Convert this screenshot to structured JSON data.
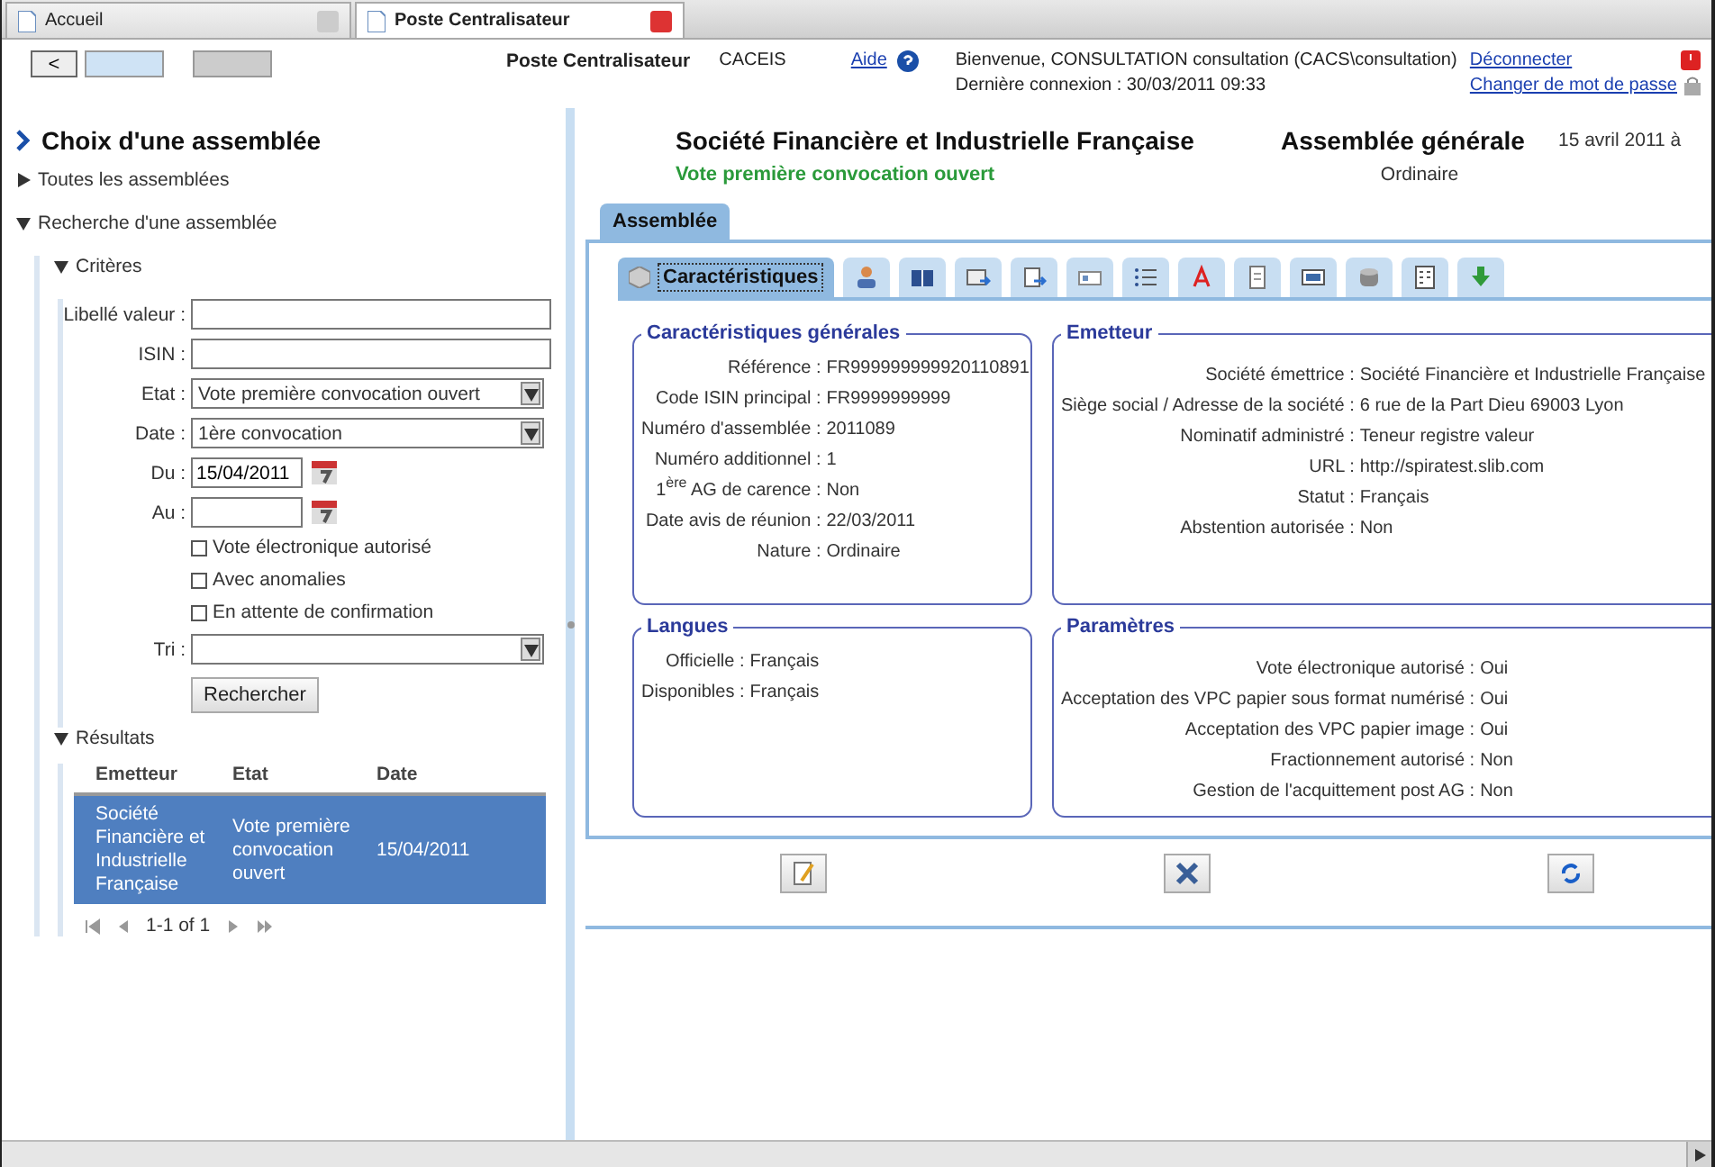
{
  "browser_tabs": [
    {
      "label": "Accueil",
      "selected": false
    },
    {
      "label": "Poste Centralisateur",
      "selected": true
    }
  ],
  "header": {
    "back": "<",
    "app_title": "Poste Centralisateur",
    "company": "CACEIS",
    "help": "Aide",
    "welcome": "Bienvenue, CONSULTATION consultation (CACS\\consultation)",
    "last_login": "Dernière connexion : 30/03/2011 09:33",
    "logout": "Déconnecter",
    "change_password": "Changer de mot de passe"
  },
  "sidebar": {
    "title": "Choix d'une assemblée",
    "sections": [
      {
        "label": "Toutes les assemblées",
        "expanded": false
      },
      {
        "label": "Recherche d'une assemblée",
        "expanded": true
      }
    ],
    "criteria": {
      "label": "Critères",
      "expanded": true,
      "fields": [
        {
          "kind": "text",
          "label": "Libellé valeur :"
        },
        {
          "kind": "text",
          "label": "ISIN :"
        },
        {
          "kind": "select",
          "label": "Etat :",
          "value": "Vote première convocation ouvert"
        },
        {
          "kind": "select",
          "label": "Date :",
          "value": "1ère convocation"
        },
        {
          "kind": "date",
          "label": "Du :",
          "value": "15/04/2011"
        },
        {
          "kind": "date",
          "label": "Au :"
        }
      ],
      "checkboxes": [
        {
          "label": "Vote électronique autorisé",
          "checked": false
        },
        {
          "label": "Avec anomalies",
          "checked": false
        },
        {
          "label": "En attente de confirmation",
          "checked": false
        }
      ],
      "sort": {
        "label": "Tri :"
      },
      "search_button": "Rechercher"
    },
    "results": {
      "label": "Résultats",
      "expanded": true,
      "columns": [
        "Emetteur",
        "Etat",
        "Date"
      ],
      "rows": [
        {
          "cells": [
            "Société Financière et Industrielle Française",
            "Vote première convocation ouvert",
            "15/04/2011"
          ],
          "selected": true
        }
      ],
      "pager": "1-1 of 1"
    }
  },
  "main": {
    "company": "Société Financière et Industrielle Française",
    "status": "Vote première convocation ouvert",
    "meeting_type": "Assemblée générale",
    "meeting_subtype": "Ordinaire",
    "date": "15 avril 2011 à",
    "section_tab": "Assemblée",
    "tabs": [
      {
        "label": "Caractéristiques",
        "selected": true
      },
      {
        "selected": false
      },
      {
        "selected": false
      },
      {
        "selected": false
      },
      {
        "selected": false
      },
      {
        "selected": false
      },
      {
        "selected": false
      },
      {
        "selected": false
      },
      {
        "selected": false
      },
      {
        "selected": false
      },
      {
        "selected": false
      },
      {
        "selected": false
      },
      {
        "selected": false
      }
    ],
    "panels": [
      {
        "title": "Caractéristiques générales",
        "rows": [
          [
            "Référence :",
            "FR999999999920110891"
          ],
          [
            "Code ISIN principal :",
            "FR9999999999"
          ],
          [
            "Numéro d'assemblée :",
            "2011089"
          ],
          [
            "Numéro additionnel :",
            "1"
          ],
          [
            "1$^{ère}$ AG de carence :",
            "Non"
          ],
          [
            "Date avis de réunion :",
            "22/03/2011"
          ],
          [
            "Nature :",
            "Ordinaire"
          ]
        ]
      },
      {
        "title": "Emetteur",
        "rows": [
          [
            "Société émettrice :",
            "Société Financière et Industrielle Française"
          ],
          [
            "Siège social / Adresse de la société :",
            "6 rue de la Part Dieu 69003 Lyon"
          ],
          [
            "Nominatif administré :",
            "Teneur registre valeur"
          ],
          [
            "URL :",
            "http://spiratest.slib.com"
          ],
          [
            "Statut :",
            "Français"
          ],
          [
            "Abstention autorisée :",
            "Non"
          ]
        ]
      },
      {
        "title": "Langues",
        "rows": [
          [
            "Officielle :",
            "Français"
          ],
          [
            "Disponibles :",
            "Français"
          ]
        ]
      },
      {
        "title": "Paramètres",
        "rows": [
          [
            "Vote électronique autorisé :",
            "Oui"
          ],
          [
            "Acceptation des VPC papier sous format numérisé :",
            "Oui"
          ],
          [
            "Acceptation des VPC papier image :",
            "Oui"
          ],
          [
            "Fractionnement autorisé :",
            "Non"
          ],
          [
            "Gestion de l'acquittement post AG :",
            "Non"
          ]
        ]
      }
    ]
  }
}
